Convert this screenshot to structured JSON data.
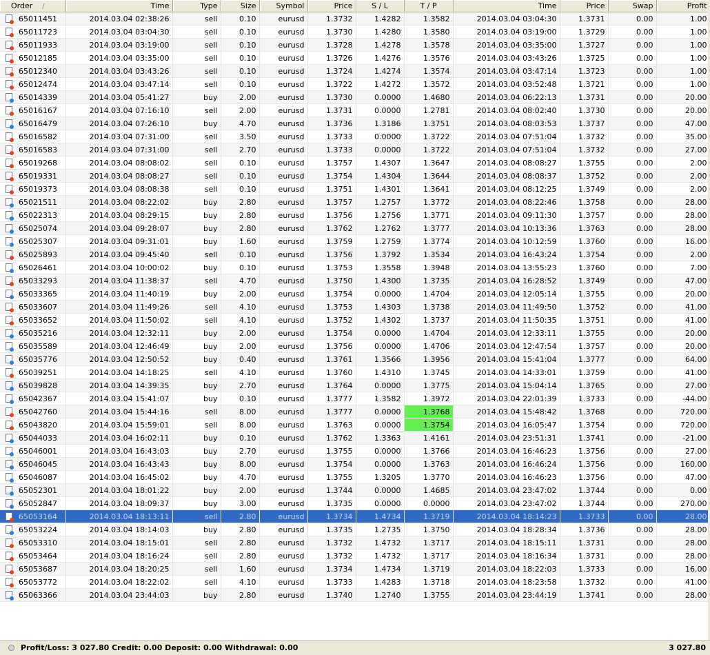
{
  "columns": [
    {
      "key": "order",
      "label": "Order"
    },
    {
      "key": "open_time",
      "label": "Time"
    },
    {
      "key": "type",
      "label": "Type"
    },
    {
      "key": "size",
      "label": "Size"
    },
    {
      "key": "symbol",
      "label": "Symbol"
    },
    {
      "key": "open_price",
      "label": "Price"
    },
    {
      "key": "sl",
      "label": "S / L"
    },
    {
      "key": "tp",
      "label": "T / P"
    },
    {
      "key": "close_time",
      "label": "Time"
    },
    {
      "key": "close_price",
      "label": "Price"
    },
    {
      "key": "swap",
      "label": "Swap"
    },
    {
      "key": "profit",
      "label": "Profit"
    }
  ],
  "sort_indicator": "/",
  "colors": {
    "selected_row": "#316ac5",
    "tp_hit": "#66ee55",
    "sell_icon": "#e5431c",
    "buy_icon": "#2f7fd6"
  },
  "rows": [
    [
      "65011451",
      "2014.03.04 02:38:26",
      "sell",
      "0.10",
      "eurusd",
      "1.3732",
      "1.4282",
      "1.3582",
      "2014.03.04 03:04:30",
      "1.3731",
      "0.00",
      "1.00"
    ],
    [
      "65011723",
      "2014.03.04 03:04:30",
      "sell",
      "0.10",
      "eurusd",
      "1.3730",
      "1.4280",
      "1.3580",
      "2014.03.04 03:19:00",
      "1.3729",
      "0.00",
      "1.00"
    ],
    [
      "65011933",
      "2014.03.04 03:19:00",
      "sell",
      "0.10",
      "eurusd",
      "1.3728",
      "1.4278",
      "1.3578",
      "2014.03.04 03:35:00",
      "1.3727",
      "0.00",
      "1.00"
    ],
    [
      "65012185",
      "2014.03.04 03:35:00",
      "sell",
      "0.10",
      "eurusd",
      "1.3726",
      "1.4276",
      "1.3576",
      "2014.03.04 03:43:26",
      "1.3725",
      "0.00",
      "1.00"
    ],
    [
      "65012340",
      "2014.03.04 03:43:26",
      "sell",
      "0.10",
      "eurusd",
      "1.3724",
      "1.4274",
      "1.3574",
      "2014.03.04 03:47:14",
      "1.3723",
      "0.00",
      "1.00"
    ],
    [
      "65012474",
      "2014.03.04 03:47:14",
      "sell",
      "0.10",
      "eurusd",
      "1.3722",
      "1.4272",
      "1.3572",
      "2014.03.04 03:52:48",
      "1.3721",
      "0.00",
      "1.00"
    ],
    [
      "65014339",
      "2014.03.04 05:41:27",
      "buy",
      "2.00",
      "eurusd",
      "1.3730",
      "0.0000",
      "1.4680",
      "2014.03.04 06:22:13",
      "1.3731",
      "0.00",
      "20.00"
    ],
    [
      "65016167",
      "2014.03.04 07:16:10",
      "sell",
      "2.00",
      "eurusd",
      "1.3731",
      "0.0000",
      "1.2781",
      "2014.03.04 08:02:40",
      "1.3730",
      "0.00",
      "20.00"
    ],
    [
      "65016479",
      "2014.03.04 07:26:10",
      "buy",
      "4.70",
      "eurusd",
      "1.3736",
      "1.3186",
      "1.3751",
      "2014.03.04 08:03:53",
      "1.3737",
      "0.00",
      "47.00"
    ],
    [
      "65016582",
      "2014.03.04 07:31:00",
      "sell",
      "3.50",
      "eurusd",
      "1.3733",
      "0.0000",
      "1.3722",
      "2014.03.04 07:51:04",
      "1.3732",
      "0.00",
      "35.00"
    ],
    [
      "65016583",
      "2014.03.04 07:31:00",
      "sell",
      "2.70",
      "eurusd",
      "1.3733",
      "0.0000",
      "1.3722",
      "2014.03.04 07:51:04",
      "1.3732",
      "0.00",
      "27.00"
    ],
    [
      "65019268",
      "2014.03.04 08:08:02",
      "sell",
      "0.10",
      "eurusd",
      "1.3757",
      "1.4307",
      "1.3647",
      "2014.03.04 08:08:27",
      "1.3755",
      "0.00",
      "2.00"
    ],
    [
      "65019331",
      "2014.03.04 08:08:27",
      "sell",
      "0.10",
      "eurusd",
      "1.3754",
      "1.4304",
      "1.3644",
      "2014.03.04 08:08:37",
      "1.3752",
      "0.00",
      "2.00"
    ],
    [
      "65019373",
      "2014.03.04 08:08:38",
      "sell",
      "0.10",
      "eurusd",
      "1.3751",
      "1.4301",
      "1.3641",
      "2014.03.04 08:12:25",
      "1.3749",
      "0.00",
      "2.00"
    ],
    [
      "65021511",
      "2014.03.04 08:22:02",
      "buy",
      "2.80",
      "eurusd",
      "1.3757",
      "1.2757",
      "1.3772",
      "2014.03.04 08:22:46",
      "1.3758",
      "0.00",
      "28.00"
    ],
    [
      "65022313",
      "2014.03.04 08:29:15",
      "buy",
      "2.80",
      "eurusd",
      "1.3756",
      "1.2756",
      "1.3771",
      "2014.03.04 09:11:30",
      "1.3757",
      "0.00",
      "28.00"
    ],
    [
      "65025074",
      "2014.03.04 09:28:07",
      "buy",
      "2.80",
      "eurusd",
      "1.3762",
      "1.2762",
      "1.3777",
      "2014.03.04 10:13:36",
      "1.3763",
      "0.00",
      "28.00"
    ],
    [
      "65025307",
      "2014.03.04 09:31:01",
      "buy",
      "1.60",
      "eurusd",
      "1.3759",
      "1.2759",
      "1.3774",
      "2014.03.04 10:12:59",
      "1.3760",
      "0.00",
      "16.00"
    ],
    [
      "65025893",
      "2014.03.04 09:45:40",
      "sell",
      "0.10",
      "eurusd",
      "1.3756",
      "1.3792",
      "1.3534",
      "2014.03.04 16:43:24",
      "1.3754",
      "0.00",
      "2.00"
    ],
    [
      "65026461",
      "2014.03.04 10:00:02",
      "buy",
      "0.10",
      "eurusd",
      "1.3753",
      "1.3558",
      "1.3948",
      "2014.03.04 13:55:23",
      "1.3760",
      "0.00",
      "7.00"
    ],
    [
      "65033293",
      "2014.03.04 11:38:37",
      "sell",
      "4.70",
      "eurusd",
      "1.3750",
      "1.4300",
      "1.3735",
      "2014.03.04 16:28:52",
      "1.3749",
      "0.00",
      "47.00"
    ],
    [
      "65033365",
      "2014.03.04 11:40:19",
      "buy",
      "2.00",
      "eurusd",
      "1.3754",
      "0.0000",
      "1.4704",
      "2014.03.04 12:05:14",
      "1.3755",
      "0.00",
      "20.00"
    ],
    [
      "65033607",
      "2014.03.04 11:49:26",
      "sell",
      "4.10",
      "eurusd",
      "1.3753",
      "1.4303",
      "1.3738",
      "2014.03.04 11:49:50",
      "1.3752",
      "0.00",
      "41.00"
    ],
    [
      "65033652",
      "2014.03.04 11:50:02",
      "sell",
      "4.10",
      "eurusd",
      "1.3752",
      "1.4302",
      "1.3737",
      "2014.03.04 11:50:35",
      "1.3751",
      "0.00",
      "41.00"
    ],
    [
      "65035216",
      "2014.03.04 12:32:11",
      "buy",
      "2.00",
      "eurusd",
      "1.3754",
      "0.0000",
      "1.4704",
      "2014.03.04 12:33:11",
      "1.3755",
      "0.00",
      "20.00"
    ],
    [
      "65035589",
      "2014.03.04 12:46:49",
      "buy",
      "2.00",
      "eurusd",
      "1.3756",
      "0.0000",
      "1.4706",
      "2014.03.04 12:47:54",
      "1.3757",
      "0.00",
      "20.00"
    ],
    [
      "65035776",
      "2014.03.04 12:50:52",
      "buy",
      "0.40",
      "eurusd",
      "1.3761",
      "1.3566",
      "1.3956",
      "2014.03.04 15:41:04",
      "1.3777",
      "0.00",
      "64.00"
    ],
    [
      "65039251",
      "2014.03.04 14:18:25",
      "sell",
      "4.10",
      "eurusd",
      "1.3760",
      "1.4310",
      "1.3745",
      "2014.03.04 14:33:01",
      "1.3759",
      "0.00",
      "41.00"
    ],
    [
      "65039828",
      "2014.03.04 14:39:35",
      "buy",
      "2.70",
      "eurusd",
      "1.3764",
      "0.0000",
      "1.3775",
      "2014.03.04 15:04:14",
      "1.3765",
      "0.00",
      "27.00"
    ],
    [
      "65042367",
      "2014.03.04 15:41:07",
      "buy",
      "0.10",
      "eurusd",
      "1.3777",
      "1.3582",
      "1.3972",
      "2014.03.04 22:01:39",
      "1.3733",
      "0.00",
      "-44.00"
    ],
    [
      "65042760",
      "2014.03.04 15:44:16",
      "sell",
      "8.00",
      "eurusd",
      "1.3777",
      "0.0000",
      "1.3768",
      "2014.03.04 15:48:42",
      "1.3768",
      "0.00",
      "720.00"
    ],
    [
      "65043820",
      "2014.03.04 15:59:01",
      "sell",
      "8.00",
      "eurusd",
      "1.3763",
      "0.0000",
      "1.3754",
      "2014.03.04 16:05:47",
      "1.3754",
      "0.00",
      "720.00"
    ],
    [
      "65044033",
      "2014.03.04 16:02:11",
      "buy",
      "0.10",
      "eurusd",
      "1.3762",
      "1.3363",
      "1.4161",
      "2014.03.04 23:51:31",
      "1.3741",
      "0.00",
      "-21.00"
    ],
    [
      "65046001",
      "2014.03.04 16:43:03",
      "buy",
      "2.70",
      "eurusd",
      "1.3755",
      "0.0000",
      "1.3766",
      "2014.03.04 16:46:23",
      "1.3756",
      "0.00",
      "27.00"
    ],
    [
      "65046045",
      "2014.03.04 16:43:43",
      "buy",
      "8.00",
      "eurusd",
      "1.3754",
      "0.0000",
      "1.3763",
      "2014.03.04 16:46:24",
      "1.3756",
      "0.00",
      "160.00"
    ],
    [
      "65046087",
      "2014.03.04 16:45:02",
      "buy",
      "4.70",
      "eurusd",
      "1.3755",
      "1.3205",
      "1.3770",
      "2014.03.04 16:46:23",
      "1.3756",
      "0.00",
      "47.00"
    ],
    [
      "65052301",
      "2014.03.04 18:01:22",
      "buy",
      "2.00",
      "eurusd",
      "1.3744",
      "0.0000",
      "1.4685",
      "2014.03.04 23:47:02",
      "1.3744",
      "0.00",
      "0.00"
    ],
    [
      "65052847",
      "2014.03.04 18:09:37",
      "buy",
      "3.00",
      "eurusd",
      "1.3735",
      "0.0000",
      "0.0000",
      "2014.03.04 23:47:02",
      "1.3744",
      "0.00",
      "270.00"
    ],
    [
      "65053164",
      "2014.03.04 18:13:11",
      "sell",
      "2.80",
      "eurusd",
      "1.3734",
      "1.4734",
      "1.3719",
      "2014.03.04 18:14:23",
      "1.3733",
      "0.00",
      "28.00"
    ],
    [
      "65053224",
      "2014.03.04 18:14:03",
      "buy",
      "2.80",
      "eurusd",
      "1.3735",
      "1.2735",
      "1.3750",
      "2014.03.04 18:28:34",
      "1.3736",
      "0.00",
      "28.00"
    ],
    [
      "65053310",
      "2014.03.04 18:15:01",
      "sell",
      "2.80",
      "eurusd",
      "1.3732",
      "1.4732",
      "1.3717",
      "2014.03.04 18:15:11",
      "1.3731",
      "0.00",
      "28.00"
    ],
    [
      "65053464",
      "2014.03.04 18:16:24",
      "sell",
      "2.80",
      "eurusd",
      "1.3732",
      "1.4732",
      "1.3717",
      "2014.03.04 18:16:34",
      "1.3731",
      "0.00",
      "28.00"
    ],
    [
      "65053687",
      "2014.03.04 18:20:25",
      "sell",
      "1.60",
      "eurusd",
      "1.3734",
      "1.4734",
      "1.3719",
      "2014.03.04 18:22:03",
      "1.3733",
      "0.00",
      "16.00"
    ],
    [
      "65053772",
      "2014.03.04 18:22:02",
      "sell",
      "4.10",
      "eurusd",
      "1.3733",
      "1.4283",
      "1.3718",
      "2014.03.04 18:23:58",
      "1.3732",
      "0.00",
      "41.00"
    ],
    [
      "65063366",
      "2014.03.04 23:44:03",
      "buy",
      "2.80",
      "eurusd",
      "1.3740",
      "1.2740",
      "1.3755",
      "2014.03.04 23:44:19",
      "1.3741",
      "0.00",
      "28.00"
    ]
  ],
  "selected_order": "65053164",
  "tp_highlight_orders": [
    "65042760",
    "65043820"
  ],
  "status": {
    "summary": "Profit/Loss: 3 027.80  Credit: 0.00  Deposit: 0.00  Withdrawal: 0.00",
    "total": "3 027.80"
  }
}
